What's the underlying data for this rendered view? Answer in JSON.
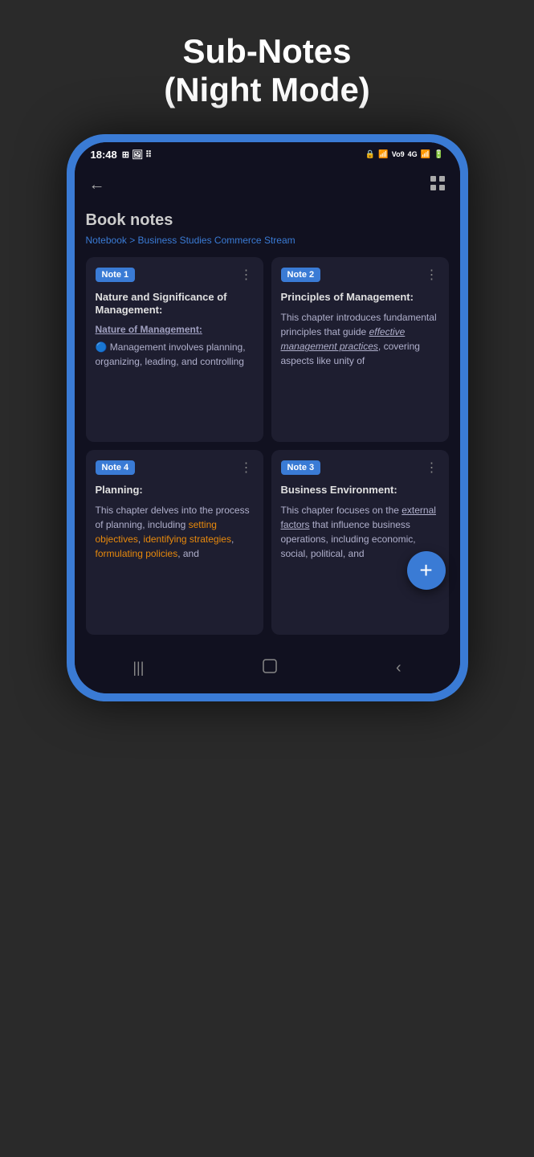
{
  "header": {
    "title_line1": "Sub-Notes",
    "title_line2": "(Night Mode)"
  },
  "status_bar": {
    "time": "18:48",
    "right_icons": "🔒 📶 Vo9 4G 🔋"
  },
  "app_bar": {
    "back_icon": "←",
    "grid_icon": "⊞"
  },
  "content": {
    "book_title": "Book notes",
    "breadcrumb": "Notebook > Business Studies Commerce Stream",
    "notes": [
      {
        "id": "note1",
        "badge": "Note 1",
        "title": "Nature and Significance of Management:",
        "subtitle": "Nature of Management:",
        "body_prefix": "1️⃣ Management involves planning, organizing, leading, and controlling",
        "body_special": null,
        "body_suffix": null,
        "italic_part": null,
        "underline_part": null
      },
      {
        "id": "note2",
        "badge": "Note 2",
        "title": "Principles of Management:",
        "body_text": "This chapter introduces fundamental principles that guide ",
        "italic_underline": "effective management practices",
        "body_suffix": ", covering aspects like unity of"
      },
      {
        "id": "note4",
        "badge": "Note 4",
        "title": "Planning:",
        "body_prefix": "This chapter delves into the process of planning, including ",
        "orange_parts": [
          "setting objectives",
          "identifying strategies",
          "formulating policies"
        ],
        "body_suffix": ", and"
      },
      {
        "id": "note3",
        "badge": "Note 3",
        "title": "Business Environment:",
        "body_prefix": "This chapter focuses on the ",
        "underline_part": "external factors",
        "body_suffix": " that influence business operations, including economic, social, political, and"
      }
    ]
  },
  "fab": {
    "label": "+"
  },
  "bottom_nav": {
    "icons": [
      "|||",
      "○",
      "<"
    ]
  }
}
